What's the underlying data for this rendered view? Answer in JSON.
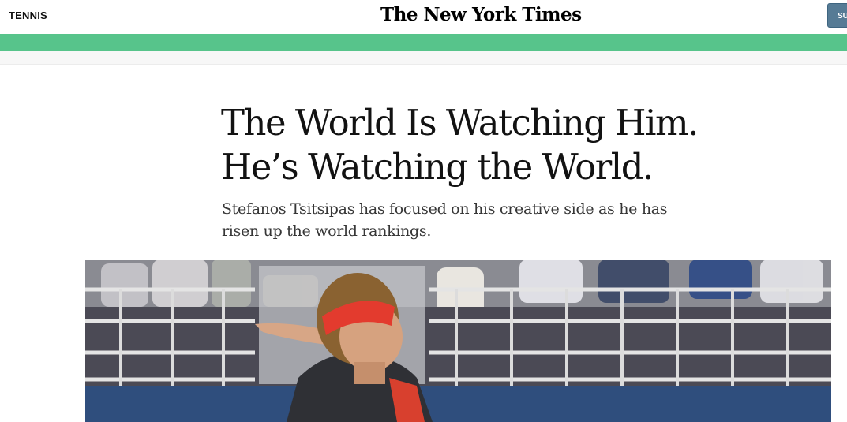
{
  "header": {
    "section": "TENNIS",
    "masthead": "The New York Times",
    "subscribe_label": "SUBSCRIBE"
  },
  "article": {
    "headline_line1": "The World Is Watching Him.",
    "headline_line2": "He’s Watching the World.",
    "summary": "Stefanos Tsitsipas has focused on his creative side as he has risen up the world rankings."
  },
  "colors": {
    "accent_bar": "#57c48b",
    "subscribe_button": "#567b95"
  }
}
